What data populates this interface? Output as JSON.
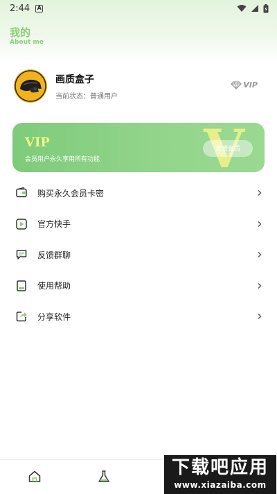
{
  "status_bar": {
    "time": "2:44",
    "notification_icon": "A"
  },
  "header": {
    "title": "我的",
    "subtitle": "About me"
  },
  "profile": {
    "name": "画质盒子",
    "status": "当前状态：普通用户",
    "vip_badge": "VIP"
  },
  "vip_card": {
    "title": "VIP",
    "description": "会员用户永久享用所有功能",
    "button_label": "邀请会员",
    "decoration": "V"
  },
  "menu": {
    "items": [
      {
        "label": "购买永久会员卡密",
        "icon": "wallet-icon"
      },
      {
        "label": "官方快手",
        "icon": "play-icon"
      },
      {
        "label": "反馈群聊",
        "icon": "chat-icon"
      },
      {
        "label": "使用帮助",
        "icon": "book-icon"
      },
      {
        "label": "分享软件",
        "icon": "share-icon"
      }
    ]
  },
  "bottom_nav": {
    "items": [
      "home-icon",
      "flask-icon"
    ]
  },
  "watermark": {
    "top": "下载吧应用",
    "bottom": "www.xiazaiba.com"
  },
  "colors": {
    "accent": "#8bcf7a",
    "vip_card": "#8fd386",
    "vip_text": "#f4f78a"
  }
}
